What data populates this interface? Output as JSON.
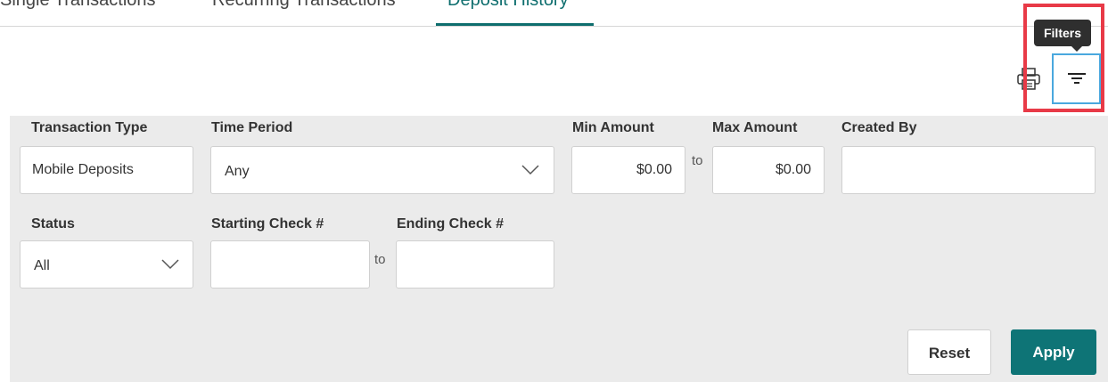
{
  "tabs": [
    {
      "label": "Single Transactions"
    },
    {
      "label": "Recurring Transactions"
    },
    {
      "label": "Deposit History"
    }
  ],
  "active_tab": "Deposit History",
  "toolbar": {
    "print_icon": "printer-icon",
    "filter_icon": "filter-lines-icon",
    "filter_tooltip": "Filters"
  },
  "filters": {
    "transaction_type": {
      "label": "Transaction Type",
      "value": "Mobile Deposits"
    },
    "time_period": {
      "label": "Time Period",
      "value": "Any"
    },
    "min_amount": {
      "label": "Min Amount",
      "value": "$0.00"
    },
    "range_to": "to",
    "max_amount": {
      "label": "Max Amount",
      "value": "$0.00"
    },
    "created_by": {
      "label": "Created By",
      "value": ""
    },
    "status": {
      "label": "Status",
      "value": "All"
    },
    "starting_check": {
      "label": "Starting Check #",
      "value": ""
    },
    "ending_check": {
      "label": "Ending Check #",
      "value": ""
    }
  },
  "actions": {
    "reset_label": "Reset",
    "apply_label": "Apply"
  },
  "colors": {
    "accent": "#0e7476",
    "panel_bg": "#ebebeb",
    "highlight": "#e83a47",
    "focus": "#4aa8de"
  }
}
